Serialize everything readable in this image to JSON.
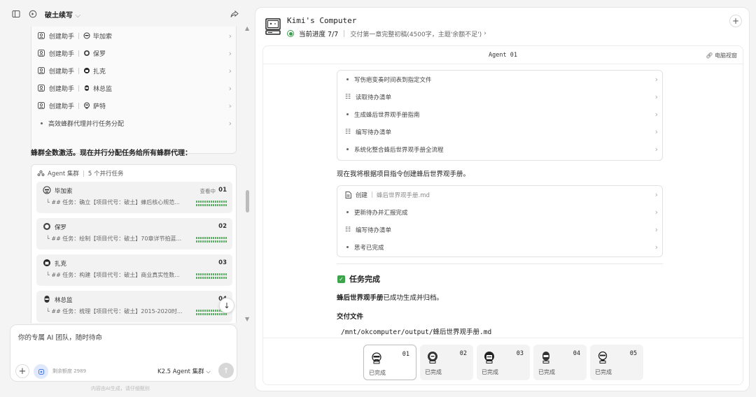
{
  "left": {
    "title": "破土续写",
    "title_chevron": "⌵",
    "creation_items": [
      {
        "action": "创建助手",
        "name": "毕加索",
        "avatar": "picasso-avatar"
      },
      {
        "action": "创建助手",
        "name": "保罗",
        "avatar": "paul-avatar"
      },
      {
        "action": "创建助手",
        "name": "扎克",
        "avatar": "zach-avatar"
      },
      {
        "action": "创建助手",
        "name": "林总监",
        "avatar": "lin-avatar"
      },
      {
        "action": "创建助手",
        "name": "萨特",
        "avatar": "sartre-avatar"
      }
    ],
    "last_item": "高效蜂群代理并行任务分配",
    "message": "蜂群全数激活。现在并行分配任务给所有蜂群代理：",
    "swarm": {
      "label": "Agent 集群",
      "count": "5 个并行任务",
      "agents": [
        {
          "name": "毕加索",
          "num": "01",
          "status": "查看中",
          "task": "## 任务：确立【项目代号：破土】蜂后核心规范..."
        },
        {
          "name": "保罗",
          "num": "02",
          "status": "",
          "task": "## 任务：绘制【项目代号：破土】70章详节拍蓝..."
        },
        {
          "name": "扎克",
          "num": "03",
          "status": "",
          "task": "## 任务：构建【项目代号：破土】商业真实性数..."
        },
        {
          "name": "林总监",
          "num": "04",
          "status": "",
          "task": "## 任务：梳理【项目代号：破土】2015-2020时..."
        }
      ]
    },
    "input_placeholder": "你的专属 AI 团队，随时待命",
    "quota": "剩余额度 2989",
    "model": "K2.5 Agent 集群 ⌵",
    "footer": "内容由AI生成，请仔细甄别"
  },
  "right": {
    "title": "Kimi's Computer",
    "progress": "当前进度 7/7",
    "deliverable": "交付第一章完整初稿(4500字，主题'余额不足')",
    "agent_label": "Agent 01",
    "view_label": "电脑视窗",
    "steps_a": [
      {
        "type": "dot",
        "text": "写伤疤变奏时间表到指定文件"
      },
      {
        "type": "list",
        "text": "读取待办清单"
      },
      {
        "type": "dot",
        "text": "生成蜂后世界观手册指南"
      },
      {
        "type": "list",
        "text": "编写待办清单"
      },
      {
        "type": "dot",
        "text": "系统化整合蜂后世界观手册全流程"
      }
    ],
    "msg1": "现在我将根据项目指令创建蜂后世界观手册。",
    "steps_b": [
      {
        "type": "file",
        "text": "创建",
        "file": "蜂后世界观手册.md"
      },
      {
        "type": "dot",
        "text": "更新待办并汇报完成"
      },
      {
        "type": "list",
        "text": "编写待办清单"
      },
      {
        "type": "dot",
        "text": "思考已完成"
      }
    ],
    "done_title": "任务完成",
    "done_msg_bold": "蜂后世界观手册",
    "done_msg_rest": "已成功生成并归档。",
    "deliver_title": "交付文件",
    "path": "/mnt/okcomputer/output/蜂后世界观手册.md",
    "agents": [
      {
        "num": "01",
        "status": "已完成"
      },
      {
        "num": "02",
        "status": "已完成"
      },
      {
        "num": "03",
        "status": "已完成"
      },
      {
        "num": "04",
        "status": "已完成"
      },
      {
        "num": "05",
        "status": "已完成"
      }
    ]
  }
}
